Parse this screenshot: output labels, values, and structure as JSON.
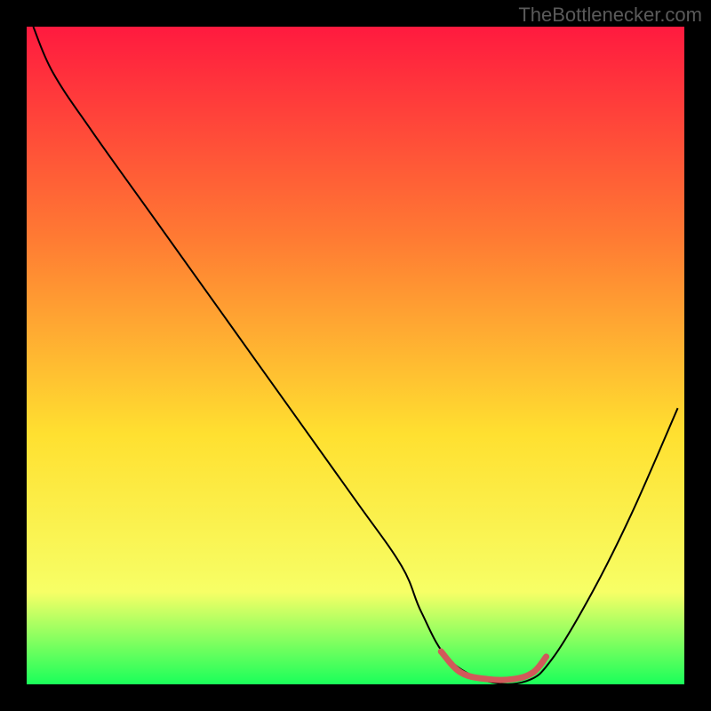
{
  "attribution": "TheBottlenecker.com",
  "chart_data": {
    "type": "line",
    "title": "",
    "xlabel": "",
    "ylabel": "",
    "xlim": [
      0,
      100
    ],
    "ylim": [
      0,
      100
    ],
    "grid": false,
    "legend": false,
    "background_gradient": {
      "top": "#ff1a3f",
      "mid_upper": "#ff7a33",
      "mid": "#ffe030",
      "lower": "#f7ff66",
      "bottom": "#1aff5a"
    },
    "series": [
      {
        "name": "bottleneck-curve",
        "color": "#000000",
        "stroke_width": 2,
        "x": [
          1,
          4,
          10,
          20,
          30,
          40,
          50,
          57,
          60,
          64,
          70,
          76,
          80,
          86,
          92,
          99
        ],
        "y": [
          100,
          93,
          84,
          70,
          56,
          42,
          28,
          18,
          11,
          4,
          0.5,
          0.5,
          4,
          14,
          26,
          42
        ]
      },
      {
        "name": "optimal-region",
        "color": "#d15a5a",
        "stroke_width": 7,
        "linecap": "round",
        "x": [
          63,
          66,
          70,
          74,
          77,
          79
        ],
        "y": [
          5,
          1.8,
          0.8,
          0.8,
          1.8,
          4.2
        ]
      }
    ]
  }
}
